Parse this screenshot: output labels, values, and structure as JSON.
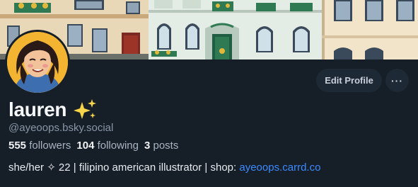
{
  "profile": {
    "display_name": "lauren",
    "name_emoji": "sparkles-icon",
    "handle": "@ayeoops.bsky.social",
    "bio_text": "she/her ✧ 22 | filipino american illustrator | shop: ",
    "bio_link": "ayeoops.carrd.co"
  },
  "stats": {
    "followers_count": "555",
    "followers_label": "followers",
    "following_count": "104",
    "following_label": "following",
    "posts_count": "3",
    "posts_label": "posts"
  },
  "actions": {
    "edit_profile_label": "Edit Profile",
    "more_label": "···"
  },
  "colors": {
    "background": "#161e27",
    "button_bg": "#1e2936",
    "link": "#3b8bff",
    "muted": "#8797a8"
  }
}
